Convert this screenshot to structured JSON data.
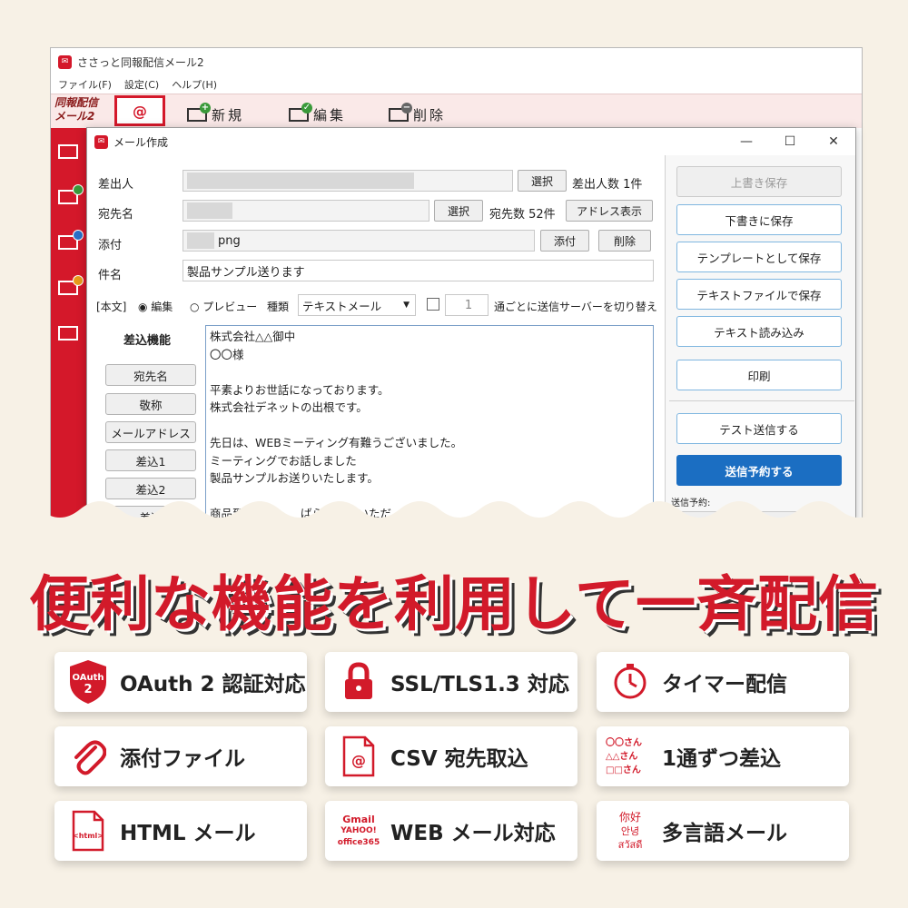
{
  "main_window": {
    "title": "ささっと同報配信メール2",
    "menu": [
      "ファイル(F)",
      "設定(C)",
      "ヘルプ(H)"
    ],
    "brand": [
      "同報配信",
      "メール2"
    ],
    "brand_mail_symbol": "@",
    "toolbar": {
      "new": "新規",
      "edit": "編集",
      "delete": "削除"
    }
  },
  "compose": {
    "title": "メール作成",
    "controls": {
      "minimize": "—",
      "maximize": "☐",
      "close": "✕"
    },
    "sender_label": "差出人",
    "select_label": "選択",
    "sender_count": "差出人数 1件",
    "recipient_label": "宛先名",
    "recipient_count": "宛先数 52件",
    "address_show": "アドレス表示",
    "attach_label": "添付",
    "attach_value": "png",
    "attach_button": "添付",
    "delete_button": "削除",
    "subject_label": "件名",
    "subject_value": "製品サンプル送ります",
    "body_mode_label": "[本文]",
    "mode_edit": "◉ 編集",
    "mode_preview": "○ プレビュー",
    "type_label": "種類",
    "type_value": "テキストメール",
    "count_value": "1",
    "switch_server_text": "通ごとに送信サーバーを切り替え",
    "merge_title": "差込機能",
    "merge_buttons": [
      "宛先名",
      "敬称",
      "メールアドレス",
      "差込1",
      "差込2",
      "差込"
    ],
    "body_lines": [
      "株式会社△△御中",
      "〇〇様",
      "",
      "平素よりお世話になっております。",
      "株式会社デネットの出根です。",
      "",
      "先日は、WEBミーティング有難うございました。",
      "ミーティングでお話しました",
      "製品サンプルお送りいたします。",
      "",
      "商品到着まで　　ばらお持ちいただ"
    ],
    "right_buttons": {
      "overwrite": "上書き保存",
      "save_draft": "下書きに保存",
      "save_template": "テンプレートとして保存",
      "save_text": "テキストファイルで保存",
      "load_text": "テキスト読み込み",
      "print": "印刷",
      "test_send": "テスト送信する",
      "schedule": "送信予約する",
      "schedule_label": "送信予約:",
      "schedule_cut": "送信予約"
    }
  },
  "headline": "便利な機能を利用して一斉配信",
  "features": [
    {
      "label": "OAuth 2 認証対応",
      "icon": "oauth-shield-icon",
      "icon_text": [
        "OAuth",
        "2"
      ]
    },
    {
      "label": "SSL/TLS1.3 対応",
      "icon": "padlock-icon"
    },
    {
      "label": "タイマー配信",
      "icon": "clock-icon"
    },
    {
      "label": "添付ファイル",
      "icon": "paperclip-icon"
    },
    {
      "label": "CSV 宛先取込",
      "icon": "csv-document-icon",
      "icon_text": [
        "@"
      ]
    },
    {
      "label": "1通ずつ差込",
      "icon": "merge-list-icon",
      "icon_text": [
        "〇〇さん",
        "△△さん",
        "□□さん"
      ]
    },
    {
      "label": "HTML メール",
      "icon": "html-document-icon",
      "icon_text": [
        "<html>"
      ]
    },
    {
      "label": "WEB メール対応",
      "icon": "webmail-logos-icon",
      "icon_text": [
        "Gmail",
        "YAHOO!",
        "office365"
      ]
    },
    {
      "label": "多言語メール",
      "icon": "multilingual-icon",
      "icon_text": [
        "你好",
        "안녕",
        "สวัสดี"
      ]
    }
  ],
  "colors": {
    "brand_red": "#d21a2a",
    "primary_blue": "#1b6ec2",
    "background": "#f7f1e6"
  }
}
